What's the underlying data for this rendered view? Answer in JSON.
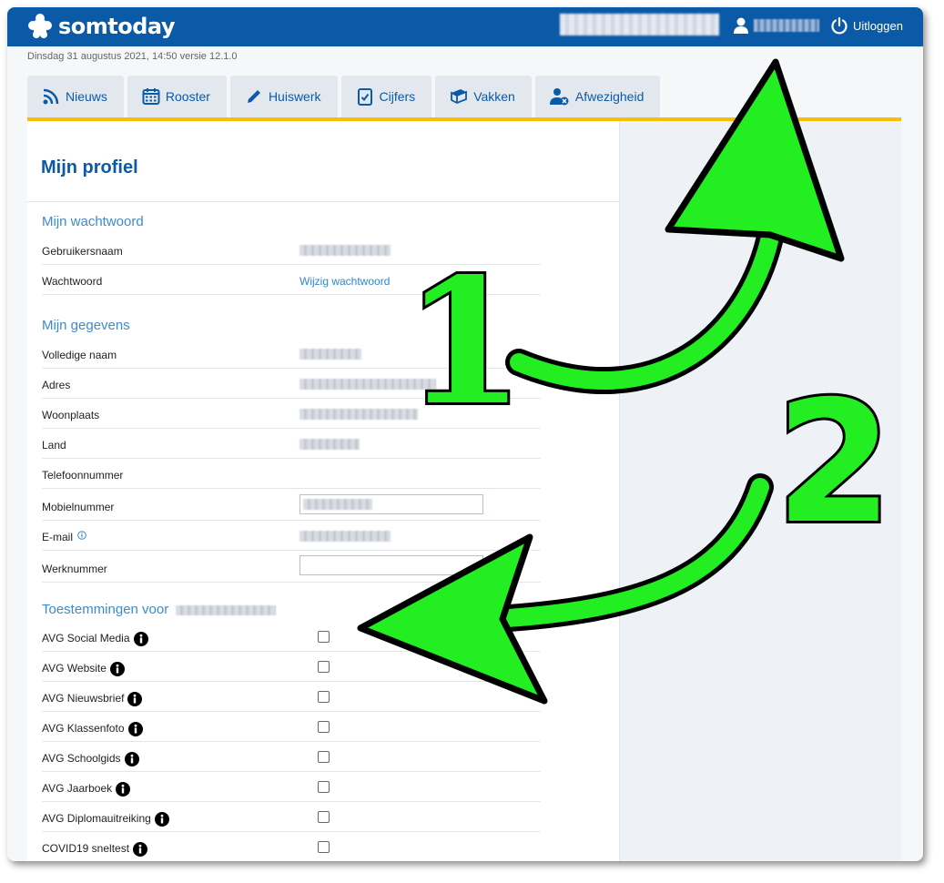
{
  "header": {
    "app_name": "somtoday",
    "logout_label": "Uitloggen",
    "brand_color": "#0a5aa8"
  },
  "datebar": "Dinsdag 31 augustus 2021, 14:50 versie 12.1.0",
  "tabs": [
    {
      "label": "Nieuws",
      "icon": "rss-icon"
    },
    {
      "label": "Rooster",
      "icon": "calendar-icon"
    },
    {
      "label": "Huiswerk",
      "icon": "pencil-icon"
    },
    {
      "label": "Cijfers",
      "icon": "grade-icon"
    },
    {
      "label": "Vakken",
      "icon": "books-icon"
    },
    {
      "label": "Afwezigheid",
      "icon": "user-absent-icon"
    }
  ],
  "page_title": "Mijn profiel",
  "password_section": {
    "title": "Mijn wachtwoord",
    "username_label": "Gebruikersnaam",
    "password_label": "Wachtwoord",
    "change_link": "Wijzig wachtwoord"
  },
  "details_section": {
    "title": "Mijn gegevens",
    "rows": [
      "Volledige naam",
      "Adres",
      "Woonplaats",
      "Land",
      "Telefoonnummer",
      "Mobielnummer",
      "E-mail",
      "Werknummer"
    ]
  },
  "permissions_section": {
    "title": "Toestemmingen voor",
    "items": [
      "AVG Social Media",
      "AVG Website",
      "AVG Nieuwsbrief",
      "AVG Klassenfoto",
      "AVG Schoolgids",
      "AVG Jaarboek",
      "AVG Diplomauitreiking",
      "COVID19 sneltest"
    ]
  },
  "annotations": {
    "label_1": "1",
    "label_2": "2",
    "arrow_color": "#22ee22"
  }
}
